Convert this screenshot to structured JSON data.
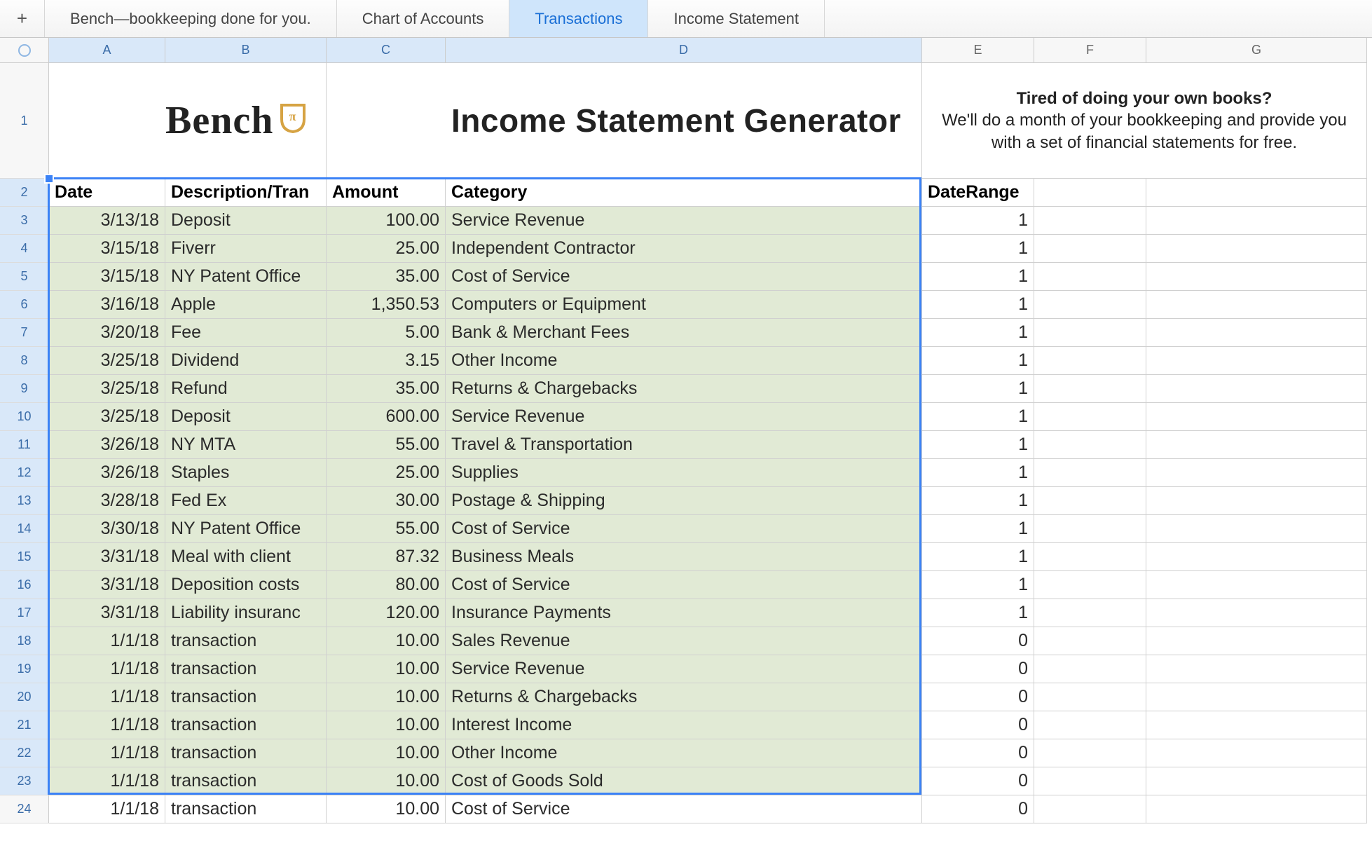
{
  "tabs": {
    "add_icon": "+",
    "items": [
      {
        "label": "Bench—bookkeeping done for you.",
        "active": false
      },
      {
        "label": "Chart of Accounts",
        "active": false
      },
      {
        "label": "Transactions",
        "active": true
      },
      {
        "label": "Income Statement",
        "active": false
      }
    ]
  },
  "columns": [
    "A",
    "B",
    "C",
    "D",
    "E",
    "F",
    "G"
  ],
  "row_numbers": [
    1,
    2,
    3,
    4,
    5,
    6,
    7,
    8,
    9,
    10,
    11,
    12,
    13,
    14,
    15,
    16,
    17,
    18,
    19,
    20,
    21,
    22,
    23,
    24
  ],
  "selection": {
    "from": "A2",
    "to": "D23"
  },
  "logo_text": "Bench",
  "title": "Income Statement Generator",
  "promo": {
    "bold": "Tired of doing your own books?",
    "rest": "We'll do a month of your bookkeeping and provide you with a set of financial statements for free."
  },
  "headers": {
    "A": "Date",
    "B": "Description/Tran",
    "C": "Amount",
    "D": "Category",
    "E": "DateRange"
  },
  "transactions": [
    {
      "date": "3/13/18",
      "desc": "Deposit",
      "amount": "100.00",
      "category": "Service Revenue",
      "daterange": "1"
    },
    {
      "date": "3/15/18",
      "desc": "Fiverr",
      "amount": "25.00",
      "category": "Independent Contractor",
      "daterange": "1"
    },
    {
      "date": "3/15/18",
      "desc": "NY Patent Office",
      "amount": "35.00",
      "category": "Cost of Service",
      "daterange": "1"
    },
    {
      "date": "3/16/18",
      "desc": "Apple",
      "amount": "1,350.53",
      "category": "Computers or Equipment",
      "daterange": "1"
    },
    {
      "date": "3/20/18",
      "desc": "Fee",
      "amount": "5.00",
      "category": "Bank & Merchant Fees",
      "daterange": "1"
    },
    {
      "date": "3/25/18",
      "desc": "Dividend",
      "amount": "3.15",
      "category": "Other Income",
      "daterange": "1"
    },
    {
      "date": "3/25/18",
      "desc": "Refund",
      "amount": "35.00",
      "category": "Returns & Chargebacks",
      "daterange": "1"
    },
    {
      "date": "3/25/18",
      "desc": "Deposit",
      "amount": "600.00",
      "category": "Service Revenue",
      "daterange": "1"
    },
    {
      "date": "3/26/18",
      "desc": "NY MTA",
      "amount": "55.00",
      "category": "Travel & Transportation",
      "daterange": "1"
    },
    {
      "date": "3/26/18",
      "desc": "Staples",
      "amount": "25.00",
      "category": "Supplies",
      "daterange": "1"
    },
    {
      "date": "3/28/18",
      "desc": "Fed Ex",
      "amount": "30.00",
      "category": "Postage & Shipping",
      "daterange": "1"
    },
    {
      "date": "3/30/18",
      "desc": "NY Patent Office",
      "amount": "55.00",
      "category": "Cost of Service",
      "daterange": "1"
    },
    {
      "date": "3/31/18",
      "desc": "Meal with client",
      "amount": "87.32",
      "category": "Business Meals",
      "daterange": "1"
    },
    {
      "date": "3/31/18",
      "desc": "Deposition costs",
      "amount": "80.00",
      "category": "Cost of Service",
      "daterange": "1"
    },
    {
      "date": "3/31/18",
      "desc": "Liability insuranc",
      "amount": "120.00",
      "category": "Insurance Payments",
      "daterange": "1"
    },
    {
      "date": "1/1/18",
      "desc": "transaction",
      "amount": "10.00",
      "category": "Sales Revenue",
      "daterange": "0"
    },
    {
      "date": "1/1/18",
      "desc": "transaction",
      "amount": "10.00",
      "category": "Service Revenue",
      "daterange": "0"
    },
    {
      "date": "1/1/18",
      "desc": "transaction",
      "amount": "10.00",
      "category": "Returns & Chargebacks",
      "daterange": "0"
    },
    {
      "date": "1/1/18",
      "desc": "transaction",
      "amount": "10.00",
      "category": "Interest Income",
      "daterange": "0"
    },
    {
      "date": "1/1/18",
      "desc": "transaction",
      "amount": "10.00",
      "category": "Other Income",
      "daterange": "0"
    },
    {
      "date": "1/1/18",
      "desc": "transaction",
      "amount": "10.00",
      "category": "Cost of Goods Sold",
      "daterange": "0"
    },
    {
      "date": "1/1/18",
      "desc": "transaction",
      "amount": "10.00",
      "category": "Cost of Service",
      "daterange": "0"
    }
  ]
}
